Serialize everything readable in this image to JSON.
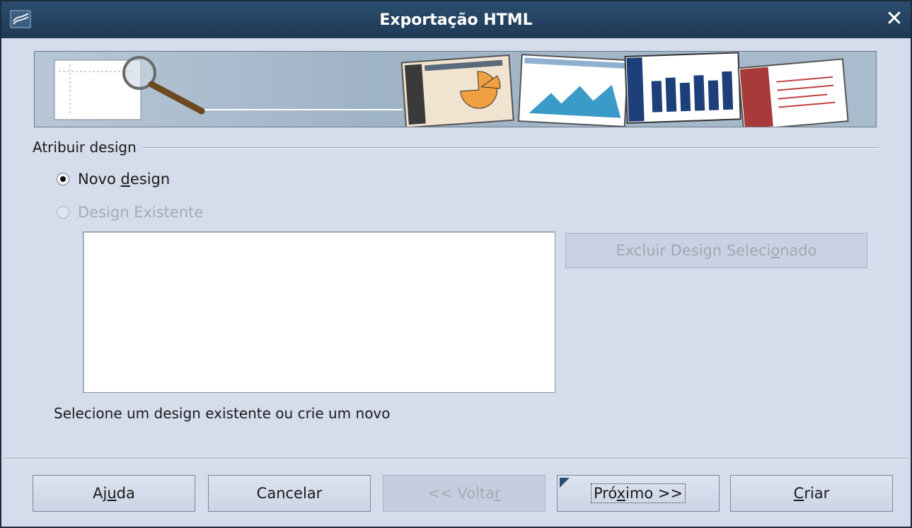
{
  "window": {
    "title": "Exportação HTML",
    "close_icon": "close-icon",
    "app_icon": "document-icon"
  },
  "group": {
    "label": "Atribuir design"
  },
  "options": {
    "new_design": {
      "pre": "Novo ",
      "key": "d",
      "post": "esign",
      "checked": true,
      "enabled": true
    },
    "existing_design": {
      "pre": "Desi",
      "key": "g",
      "post": "n Existente",
      "checked": false,
      "enabled": false
    }
  },
  "delete_button": {
    "pre": "Excluir Design Seleci",
    "key": "o",
    "post": "nado",
    "enabled": false
  },
  "hint": "Selecione um design existente ou crie um novo",
  "buttons": {
    "help": {
      "pre": "Aj",
      "key": "u",
      "post": "da"
    },
    "cancel": {
      "label": "Cancelar"
    },
    "back": {
      "pre": "<< Volta",
      "key": "r",
      "post": "",
      "enabled": false
    },
    "next": {
      "pre": "Pró",
      "key": "x",
      "post": "imo >>",
      "default": true
    },
    "create": {
      "pre": "",
      "key": "C",
      "post": "riar"
    }
  },
  "colors": {
    "titlebar": "#1e3a56",
    "dialog_bg": "#d5dcec",
    "disabled_text": "#a4abb8"
  }
}
